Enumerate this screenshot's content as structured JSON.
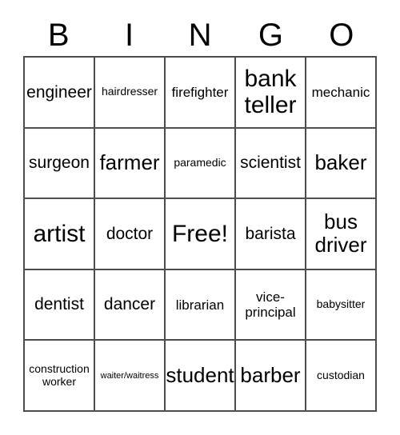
{
  "header": {
    "letters": [
      "B",
      "I",
      "N",
      "G",
      "O"
    ]
  },
  "grid": {
    "columns": 5,
    "rows": 5,
    "border_color": "#4d4d4d",
    "background_color": "#ffffff",
    "text_color": "#000000",
    "cells": [
      {
        "label": "engineer",
        "size": "fs-md"
      },
      {
        "label": "hairdresser",
        "size": "fs-xs"
      },
      {
        "label": "firefighter",
        "size": "fs-sm"
      },
      {
        "label": "bank teller",
        "size": "fs-xl"
      },
      {
        "label": "mechanic",
        "size": "fs-sm"
      },
      {
        "label": "surgeon",
        "size": "fs-md"
      },
      {
        "label": "farmer",
        "size": "fs-lg"
      },
      {
        "label": "paramedic",
        "size": "fs-xs"
      },
      {
        "label": "scientist",
        "size": "fs-md"
      },
      {
        "label": "baker",
        "size": "fs-lg"
      },
      {
        "label": "artist",
        "size": "fs-xl"
      },
      {
        "label": "doctor",
        "size": "fs-md"
      },
      {
        "label": "Free!",
        "size": "fs-xl"
      },
      {
        "label": "barista",
        "size": "fs-md"
      },
      {
        "label": "bus driver",
        "size": "fs-lg"
      },
      {
        "label": "dentist",
        "size": "fs-md"
      },
      {
        "label": "dancer",
        "size": "fs-md"
      },
      {
        "label": "librarian",
        "size": "fs-sm"
      },
      {
        "label": "vice-principal",
        "size": "fs-sm"
      },
      {
        "label": "babysitter",
        "size": "fs-xs"
      },
      {
        "label": "construction worker",
        "size": "fs-xs"
      },
      {
        "label": "waiter/waitress",
        "size": "fs-xxs"
      },
      {
        "label": "student",
        "size": "fs-lg"
      },
      {
        "label": "barber",
        "size": "fs-lg"
      },
      {
        "label": "custodian",
        "size": "fs-xs"
      }
    ]
  }
}
